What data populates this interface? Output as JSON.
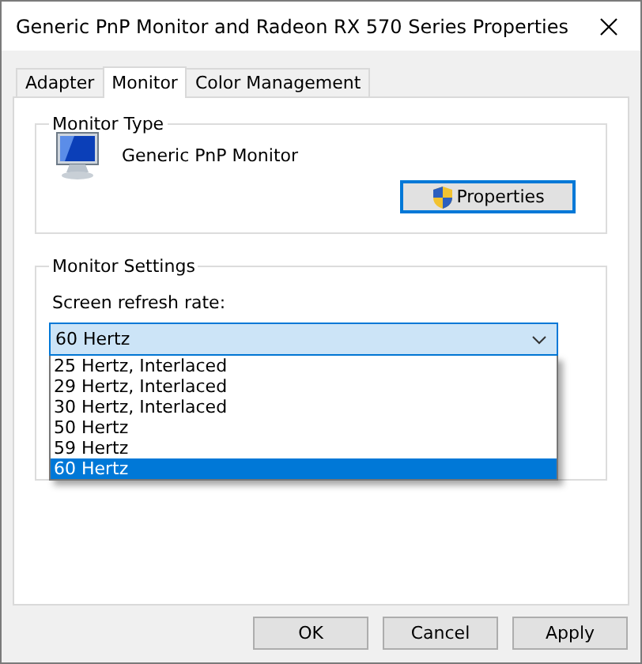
{
  "window": {
    "title": "Generic PnP Monitor and Radeon RX 570 Series Properties"
  },
  "tabs": [
    {
      "label": "Adapter",
      "selected": false
    },
    {
      "label": "Monitor",
      "selected": true
    },
    {
      "label": "Color Management",
      "selected": false
    }
  ],
  "monitor_type": {
    "legend": "Monitor Type",
    "name": "Generic PnP Monitor",
    "properties_button": "Properties"
  },
  "monitor_settings": {
    "legend": "Monitor Settings",
    "refresh_label": "Screen refresh rate:",
    "refresh_select": {
      "value": "60 Hertz",
      "expanded": true,
      "options": [
        {
          "label": "25 Hertz, Interlaced",
          "selected": false
        },
        {
          "label": "29 Hertz, Interlaced",
          "selected": false
        },
        {
          "label": "30 Hertz, Interlaced",
          "selected": false
        },
        {
          "label": "50 Hertz",
          "selected": false
        },
        {
          "label": "59 Hertz",
          "selected": false
        },
        {
          "label": "60 Hertz",
          "selected": true
        }
      ]
    }
  },
  "buttons": [
    "OK",
    "Cancel",
    "Apply"
  ]
}
